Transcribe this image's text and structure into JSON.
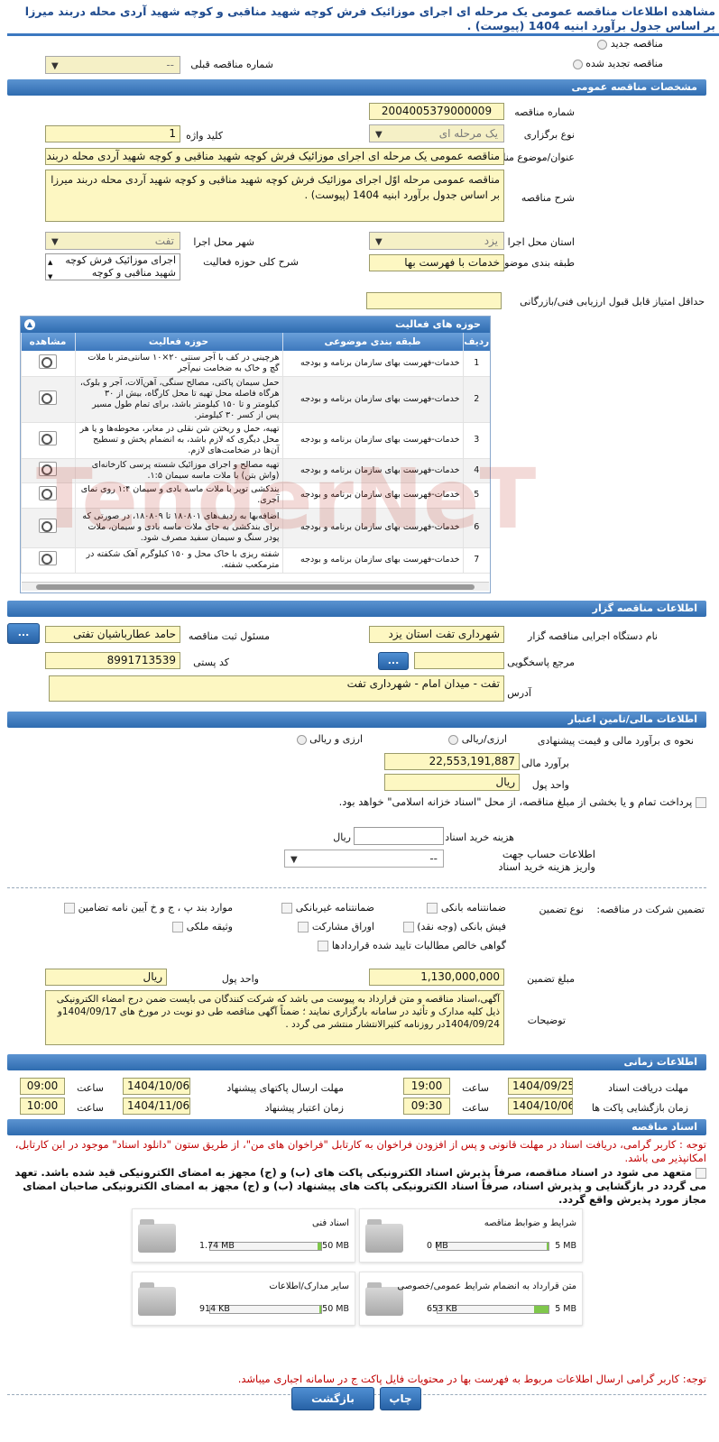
{
  "page": {
    "title": "مشاهده اطلاعات مناقصه عمومی یک مرحله ای اجرای موزائیک فرش کوچه شهید مناقبی و کوچه شهید آردی محله دربند میرزا بر اساس جدول برآورد ابنیه 1404 (پیوست) ."
  },
  "top": {
    "new_tender": "مناقصه جدید",
    "renewed_tender": "مناقصه تجدید شده",
    "prev_number_label": "شماره مناقصه قبلی",
    "prev_number_value": "--"
  },
  "general": {
    "header": "مشخصات مناقصه عمومی",
    "number_label": "شماره مناقصه",
    "number": "2004005379000009",
    "type_label": "نوع برگزاری",
    "type": "یک مرحله ای",
    "keyword_label": "کلید واژه",
    "keyword": "1",
    "subject_label": "عنوان/موضوع مناقصه",
    "subject": "مناقصه عمومی یک مرحله ای اجرای موزائیک فرش کوچه شهید مناقبی و کوچه شهید آردی محله دربند میرزا",
    "desc_label": "شرح مناقصه",
    "desc": "مناقصه عمومی مرحله اوّل اجرای موزائیک فرش کوچه شهید مناقبی و کوچه شهید آردی محله دربند میرزا بر اساس جدول برآورد ابنیه 1404 (پیوست) .",
    "province_label": "استان محل اجرا",
    "province": "یزد",
    "city_label": "شهر محل اجرا",
    "city": "تفت",
    "category_label": "طبقه بندی موضوعی",
    "category": "خدمات با فهرست بها",
    "scope_label": "شرح کلی حوزه فعالیت",
    "scope": "اجرای موزائیک فرش کوچه شهید مناقبی و کوچه",
    "min_score_label": "حداقل امتیاز قابل قبول ارزیابی فنی/بازرگانی",
    "min_score": ""
  },
  "activities": {
    "header": "حوزه های فعالیت",
    "col_row": "ردیف",
    "col_category": "طبقه بندی موضوعی",
    "col_scope": "حوزه فعالیت",
    "col_view": "مشاهده",
    "rows": [
      {
        "n": "1",
        "cat": "خدمات-فهرست بهای سازمان برنامه و بودجه",
        "scope": "هرچینی در کف با آجر سنتی ۲۰×۱۰ سانتی‌متر با ملات گچ و خاک به ضخامت نیم‌آجر"
      },
      {
        "n": "2",
        "cat": "خدمات-فهرست بهای سازمان برنامه و بودجه",
        "scope": "حمل سیمان پاکتی، مصالح سنگی، آهن‌آلات، آجر و بلوک، هرگاه فاصله محل تهیه تا محل کارگاه، بیش از ۳۰ کیلومتر و تا ۱۵۰ کیلومتر باشد، برای تمام طول مسیر پس از کسر ۳۰ کیلومتر."
      },
      {
        "n": "3",
        "cat": "خدمات-فهرست بهای سازمان برنامه و بودجه",
        "scope": "تهیه، حمل و ریختن شن نقلی در معابر، محوطه‌ها و یا هر محل دیگری که لازم باشد، به انضمام پخش و تسطیح آن‌ها در ضخامت‌های لازم."
      },
      {
        "n": "4",
        "cat": "خدمات-فهرست بهای سازمان برنامه و بودجه",
        "scope": "تهیه مصالح و اجرای موزائیک شسته پرسی کارخانه‌ای (واش بتن) با ملات ماسه سیمان ۱:۵."
      },
      {
        "n": "5",
        "cat": "خدمات-فهرست بهای سازمان برنامه و بودجه",
        "scope": "بندکشی توپر با ملات ماسه بادی و سیمان ۱:۴ روی نمای آجری."
      },
      {
        "n": "6",
        "cat": "خدمات-فهرست بهای سازمان برنامه و بودجه",
        "scope": "اضافه‌بها به ردیف‌های ۱۸۰۸۰۱ تا ۱۸۰۸۰۹، در صورتی که برای بندکشی به جای ملات ماسه بادی و سیمان، ملات پودر سنگ و سیمان سفید مصرف شود."
      },
      {
        "n": "7",
        "cat": "خدمات-فهرست بهای سازمان برنامه و بودجه",
        "scope": "شفته ریزی با خاک محل و ۱۵۰ کیلوگرم آهک شکفته در مترمکعب شفته."
      }
    ]
  },
  "org": {
    "header": "اطلاعات مناقصه گزار",
    "name_label": "نام دستگاه اجرایی مناقصه گزار",
    "name": "شهرداری تفت استان یزد",
    "resp_label": "مسئول ثبت مناقصه",
    "resp": "حامد عطارباشیان تفتی",
    "ref_label": "مرجع پاسخگویی",
    "ref": "",
    "postal_label": "کد پستی",
    "postal": "8991713539",
    "addr_label": "آدرس",
    "addr": "تفت - میدان امام - شهرداری تفت",
    "dots": "...",
    "dots2": "..."
  },
  "finance": {
    "header": "اطلاعات مالی/تامین اعتبار",
    "method_label": "نحوه ی برآورد مالی و قیمت پیشنهادی",
    "opt1": "ارزی/ریالی",
    "opt2": "ارزی و ریالی",
    "estimate_label": "برآورد مالی",
    "estimate": "22,553,191,887",
    "unit_label": "واحد پول",
    "unit": "ریال",
    "treasury": "پرداخت تمام و یا بخشی از مبلغ مناقصه، از محل \"اسناد خزانه اسلامی\" خواهد بود.",
    "doc_cost_label": "هزینه خرید اسناد",
    "doc_cost": "",
    "doc_cost_unit": "ریال",
    "account_label": "اطلاعات حساب جهت واریز هزینه خرید اسناد",
    "account": "--"
  },
  "guarantee": {
    "section_label": "تضمین شرکت در مناقصه:",
    "type_label": "نوع تضمین",
    "opts": [
      "ضمانتنامه بانکی",
      "ضمانتنامه غیربانکی",
      "موارد بند پ ، ج و خ آیین نامه تضامین",
      "فیش بانکی (وجه نقد)",
      "اوراق مشارکت",
      "وثیقه ملکی",
      "گواهی خالص مطالبات تایید شده قراردادها"
    ],
    "amount_label": "مبلغ تضمین",
    "amount": "1,130,000,000",
    "unit_label": "واحد پول",
    "unit": "ریال",
    "notes_label": "توضیحات",
    "notes": "آگهی،اسناد مناقصه و متن قرارداد به پیوست می باشد که شرکت کنندگان می بایست ضمن درج امضاء الکترونیکی ذیل کلیه مدارک و تأئید در سامانه بارگزاری نمایند ؛ ضمناً آگهی مناقصه طی دو نوبت در مورخ های 1404/09/17و 1404/09/24در روزنامه کثیرالانتشار منتشر می گردد ."
  },
  "timing": {
    "header": "اطلاعات زمانی",
    "receive_label": "مهلت دریافت اسناد",
    "receive_date": "1404/09/25",
    "receive_time": "19:00",
    "send_label": "مهلت ارسال پاکتهای پیشنهاد",
    "send_date": "1404/10/06",
    "send_time": "09:00",
    "open_label": "زمان بازگشایی پاکت ها",
    "open_date": "1404/10/06",
    "open_time": "09:30",
    "valid_label": "زمان اعتبار پیشنهاد",
    "valid_date": "1404/11/06",
    "valid_time": "10:00",
    "time_label": "ساعت"
  },
  "docs": {
    "header": "اسناد مناقصه",
    "notice": "توجه : کاربر گرامی، دریافت اسناد در مهلت قانونی و پس از افزودن فراخوان به کارتابل \"فراخوان های من\"، از طریق ستون \"دانلود اسناد\" موجود در این کارتابل، امکانپذیر می باشد.",
    "commit": "متعهد می شود در اسناد مناقصه، صرفاً پذیرش اسناد الکترونیکی پاکت های (ب) و (ج) مجهز به امضای الکترونیکی قید شده باشد. تعهد می گردد در بازگشایی و پذیرش اسناد، صرفاً اسناد الکترونیکی پاکت های پیشنهاد (ب) و (ج) مجهز به امضای الکترونیکی صاحبان امضای مجاز مورد پذیرش واقع گردد.",
    "files": [
      {
        "name": "شرایط و ضوابط مناقصه",
        "size": "0 MB",
        "max": "5 MB",
        "fill": 0.02
      },
      {
        "name": "اسناد فنی",
        "size": "1.74 MB",
        "max": "50 MB",
        "fill": 0.035
      },
      {
        "name": "متن قرارداد به انضمام شرایط عمومی/خصوصی",
        "size": "653 KB",
        "max": "5 MB",
        "fill": 0.13
      },
      {
        "name": "سایر مدارک/اطلاعات",
        "size": "914 KB",
        "max": "50 MB",
        "fill": 0.02
      }
    ],
    "bottom_notice": "توجه: کاربر گرامی ارسال اطلاعات مربوط به فهرست بها در محتویات فایل پاکت ج در سامانه اجباری میباشد."
  },
  "buttons": {
    "print": "چاپ",
    "back": "بازگشت"
  },
  "watermark": "TenderNeT"
}
